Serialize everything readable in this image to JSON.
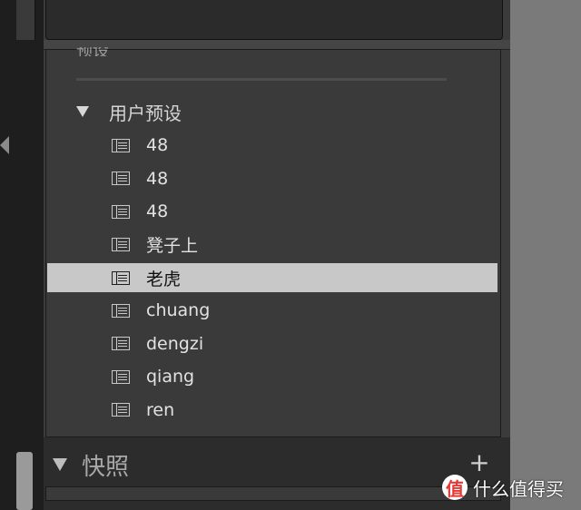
{
  "top_section": {
    "partial_label": "预设"
  },
  "user_presets": {
    "title": "用户预设",
    "items": [
      {
        "label": "48"
      },
      {
        "label": "48"
      },
      {
        "label": "48"
      },
      {
        "label": "凳子上"
      },
      {
        "label": "老虎",
        "selected": true
      },
      {
        "label": "chuang"
      },
      {
        "label": "dengzi"
      },
      {
        "label": "qiang"
      },
      {
        "label": "ren"
      }
    ]
  },
  "snapshots": {
    "title": "快照",
    "add_label": "+"
  },
  "watermark": {
    "logo": "值",
    "text": "什么值得买"
  },
  "colors": {
    "selected_row": "#c8c8c8",
    "panel": "#3a3a3a",
    "right_area": "#7a7a7a"
  },
  "icons": {
    "preset": "preset-icon",
    "expand": "triangle-down-icon",
    "add": "plus-icon"
  }
}
